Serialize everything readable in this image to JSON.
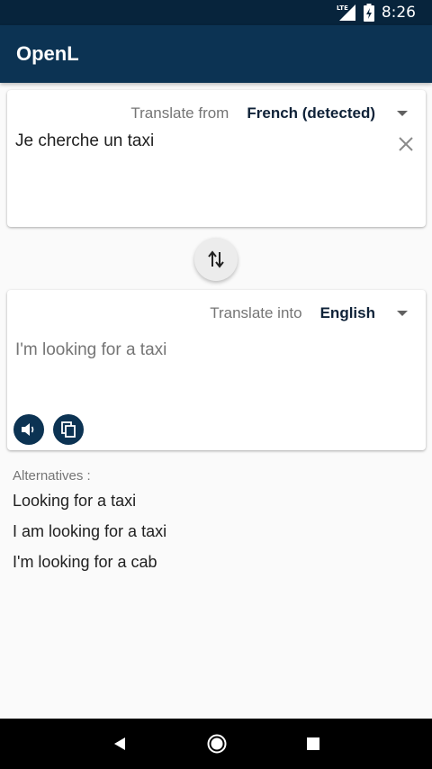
{
  "status_bar": {
    "network": "LTE",
    "time": "8:26"
  },
  "app_bar": {
    "title": "OpenL"
  },
  "source": {
    "label": "Translate from",
    "language": "French (detected)",
    "text": "Je cherche un taxi"
  },
  "target": {
    "label": "Translate into",
    "language": "English",
    "text": "I'm looking for a taxi"
  },
  "alternatives": {
    "header": "Alternatives :",
    "items": [
      "Looking for a taxi",
      "I am looking for a taxi",
      "I'm looking for a cab"
    ]
  },
  "colors": {
    "app_bar": "#0c3353",
    "status_bar": "#07243c",
    "accent": "#0c3353"
  }
}
